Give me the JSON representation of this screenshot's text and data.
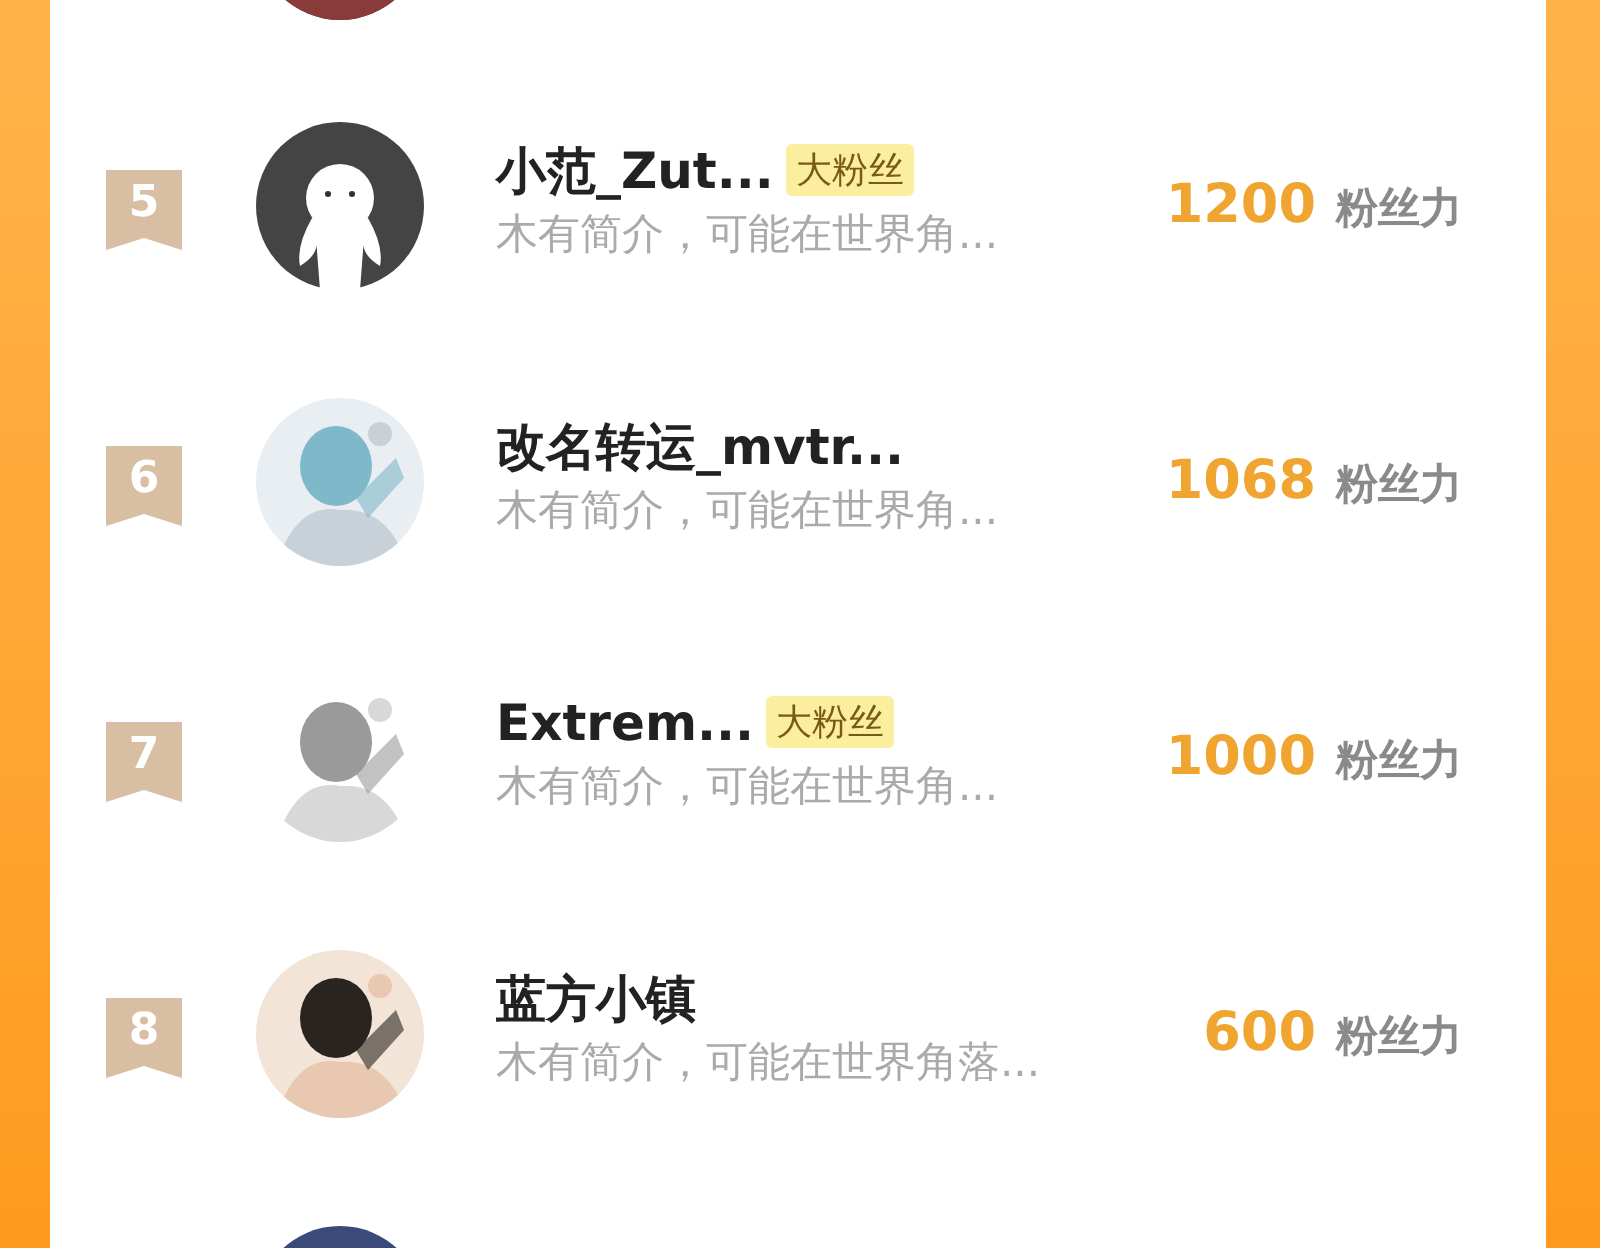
{
  "rows": [
    {
      "rank": "5",
      "avatar": {
        "kind": "default"
      },
      "name": "小范_Zut...",
      "badge": "大粉丝",
      "bio": "木有简介，可能在世界角...",
      "score": "1200",
      "unit": "粉丝力"
    },
    {
      "rank": "6",
      "name": "改名转运_mvtr...",
      "bio": "木有简介，可能在世界角...",
      "score": "1068",
      "unit": "粉丝力"
    },
    {
      "rank": "7",
      "name": "Extrem...",
      "badge": "大粉丝",
      "bio": "木有简介，可能在世界角...",
      "score": "1000",
      "unit": "粉丝力"
    },
    {
      "rank": "8",
      "name": "蓝方小镇",
      "bio": "木有简介，可能在世界角落...",
      "score": "600",
      "unit": "粉丝力"
    }
  ]
}
